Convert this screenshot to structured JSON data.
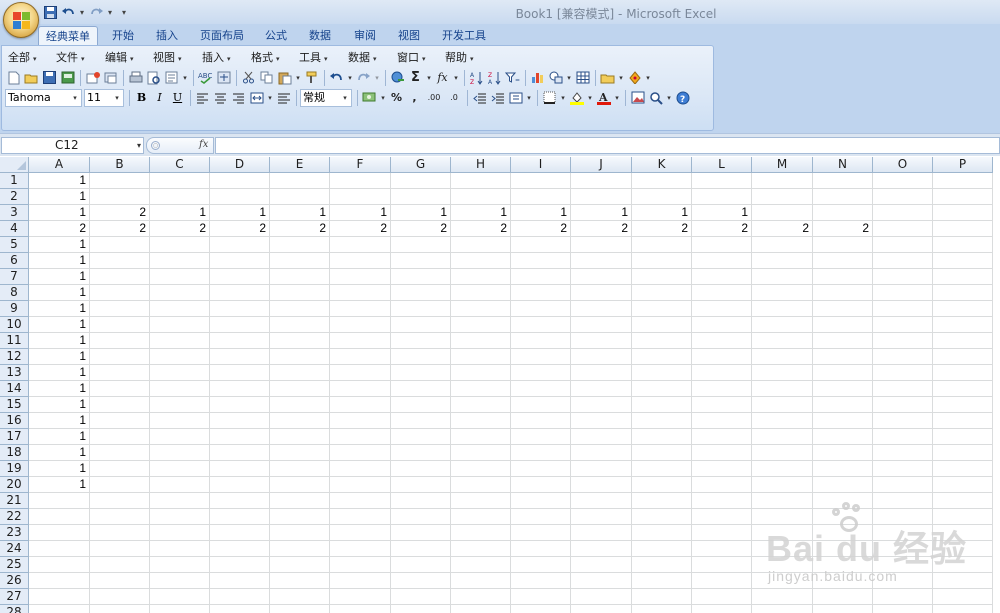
{
  "window": {
    "title": "Book1  [兼容模式] - Microsoft Excel"
  },
  "quick_access": [
    {
      "name": "save-icon",
      "glyph": "💾"
    },
    {
      "name": "undo-icon",
      "glyph": "↶"
    },
    {
      "name": "redo-icon",
      "glyph": "↷"
    },
    {
      "name": "customize-qat-icon",
      "glyph": "▾"
    }
  ],
  "ribbon_tabs": [
    "经典菜单",
    "开始",
    "插入",
    "页面布局",
    "公式",
    "数据",
    "审阅",
    "视图",
    "开发工具"
  ],
  "ribbon_active_tab": "经典菜单",
  "menus": [
    "全部",
    "文件",
    "编辑",
    "视图",
    "插入",
    "格式",
    "工具",
    "数据",
    "窗口",
    "帮助"
  ],
  "format": {
    "font": "Tahoma",
    "size": "11",
    "number_format": "常规",
    "bold": "B",
    "italic": "I",
    "underline": "U",
    "percent": "%",
    "comma": ",",
    "inc_decimal": ".00",
    "dec_decimal": ".0"
  },
  "formula_bar": {
    "name_box": "C12",
    "fx_label": "fx",
    "formula": ""
  },
  "columns": [
    "A",
    "B",
    "C",
    "D",
    "E",
    "F",
    "G",
    "H",
    "I",
    "J",
    "K",
    "L",
    "M",
    "N",
    "O",
    "P"
  ],
  "rows": [
    "1",
    "2",
    "3",
    "4",
    "5",
    "6",
    "7",
    "8",
    "9",
    "10",
    "11",
    "12",
    "13",
    "14",
    "15",
    "16",
    "17",
    "18",
    "19",
    "20",
    "21",
    "22",
    "23",
    "24",
    "25",
    "26",
    "27",
    "28"
  ],
  "cells": {
    "A1": "1",
    "A2": "1",
    "A3": "1",
    "B3": "2",
    "C3": "1",
    "D3": "1",
    "E3": "1",
    "F3": "1",
    "G3": "1",
    "H3": "1",
    "I3": "1",
    "J3": "1",
    "K3": "1",
    "L3": "1",
    "A4": "2",
    "B4": "2",
    "C4": "2",
    "D4": "2",
    "E4": "2",
    "F4": "2",
    "G4": "2",
    "H4": "2",
    "I4": "2",
    "J4": "2",
    "K4": "2",
    "L4": "2",
    "M4": "2",
    "N4": "2",
    "A5": "1",
    "A6": "1",
    "A7": "1",
    "A8": "1",
    "A9": "1",
    "A10": "1",
    "A11": "1",
    "A12": "1",
    "A13": "1",
    "A14": "1",
    "A15": "1",
    "A16": "1",
    "A17": "1",
    "A18": "1",
    "A19": "1",
    "A20": "1"
  },
  "watermark": {
    "main": "Bai du 经验",
    "sub": "jingyan.baidu.com"
  }
}
